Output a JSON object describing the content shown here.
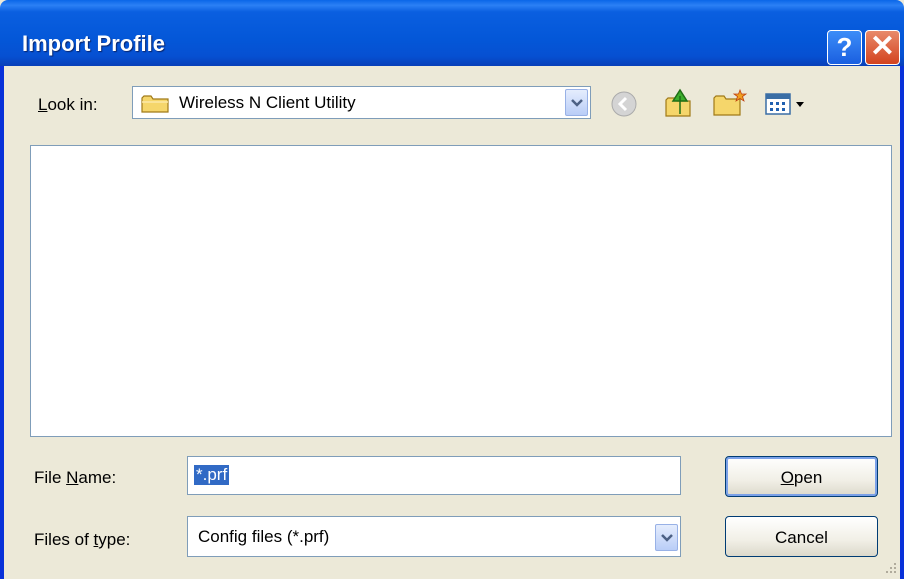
{
  "window": {
    "title": "Import Profile",
    "help_button": "?",
    "close_button": "✕"
  },
  "lookin": {
    "label_accel": "L",
    "label_rest": "ook in:",
    "value": "Wireless N Client Utility"
  },
  "toolbar": {
    "icons": [
      "back-icon",
      "up-folder-icon",
      "new-folder-icon",
      "views-menu-icon"
    ]
  },
  "filename": {
    "label_accel": "N",
    "label_pre": "File ",
    "label_post": "ame:",
    "value": "*.prf"
  },
  "filetype": {
    "label_pre": "Files of ",
    "label_accel": "t",
    "label_post": "ype:",
    "value": "Config files (*.prf)"
  },
  "buttons": {
    "open_accel": "O",
    "open_rest": "pen",
    "cancel": "Cancel"
  },
  "colors": {
    "title_bar": "#0457d8",
    "dialog_bg": "#ece9d8",
    "selection": "#316ac5",
    "close_button": "#d3431f"
  }
}
